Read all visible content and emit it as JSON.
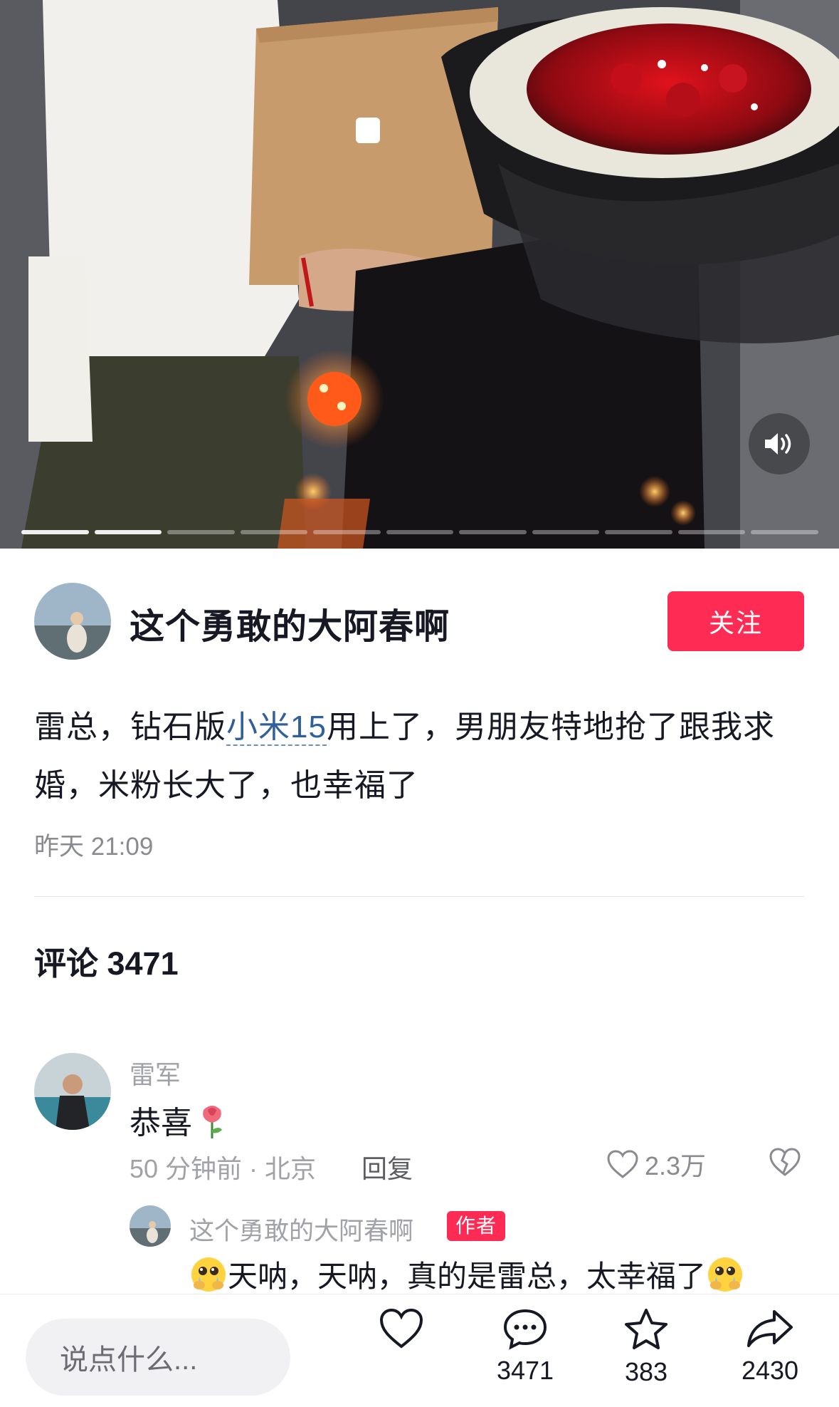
{
  "media": {
    "progress_segments": 11,
    "progress_active": 2,
    "volume_icon": "volume-icon"
  },
  "author": {
    "name": "这个勇敢的大阿春啊",
    "follow_label": "关注"
  },
  "post": {
    "caption_before": "雷总，钻石版",
    "caption_tag": "小米15",
    "caption_after": "用上了，男朋友特地抢了跟我求婚，米粉长大了，也幸福了",
    "time": "昨天 21:09"
  },
  "comments_section": {
    "heading": "评论 3471"
  },
  "comment": {
    "user": "雷军",
    "text": "恭喜",
    "time_location": "50 分钟前 · 北京",
    "reply_label": "回复",
    "likes": "2.3万"
  },
  "reply": {
    "user": "这个勇敢的大阿春啊",
    "badge": "作者",
    "text": "天呐，天呐，真的是雷总，太幸福了"
  },
  "bottom_bar": {
    "input_placeholder": "说点什么...",
    "comment_count": "3471",
    "star_count": "383",
    "share_count": "2430"
  },
  "colors": {
    "accent": "#fe2c55",
    "tag_link": "#2f5f9c"
  }
}
